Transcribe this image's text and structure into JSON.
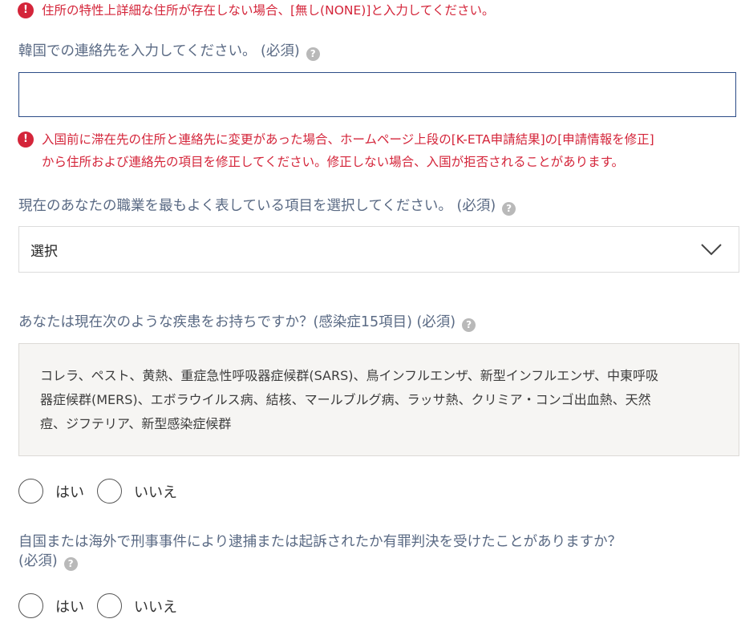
{
  "notices": {
    "none_address": "住所の特性上詳細な住所が存在しない場合、[無し(NONE)]と入力してください。",
    "change_warning": [
      "入国前に滞在先の住所と連絡先に変更があった場合、ホームページ上段の[K-ETA申請結果]の[申請情報を修正]",
      "から住所および連絡先の項目を修正してください。修正しない場合、入国が拒否されることがあります。"
    ]
  },
  "contact": {
    "label": "韓国での連絡先を入力してください。 (必須)",
    "value": ""
  },
  "occupation": {
    "label": "現在のあなたの職業を最もよく表している項目を選択してください。 (必須)",
    "selected": "選択"
  },
  "disease": {
    "label": "あなたは現在次のような疾患をお持ちですか？(感染症15項目) (必須)",
    "list_lines": [
      "コレラ、ペスト、黄熱、重症急性呼吸器症候群(SARS)、鳥インフルエンザ、新型インフルエンザ、中東呼吸",
      "器症候群(MERS)、エボラウイルス病、結核、マールブルグ病、ラッサ熱、クリミア・コンゴ出血熱、天然",
      "痘、ジフテリア、新型感染症候群"
    ],
    "options": {
      "yes": "はい",
      "no": "いいえ"
    }
  },
  "criminal": {
    "label_lines": [
      "自国または海外で刑事事件により逮捕または起訴されたか有罪判決を受けたことがありますか？",
      "(必須)"
    ],
    "options": {
      "yes": "はい",
      "no": "いいえ"
    }
  },
  "icons": {
    "alert": "exclamation-circle-icon",
    "help": "question-circle-icon",
    "dropdown": "chevron-down-icon"
  },
  "colors": {
    "error": "#d4253a",
    "label": "#5a6a84",
    "input_border": "#2c4c87",
    "info_bg": "#f6f5f3"
  }
}
